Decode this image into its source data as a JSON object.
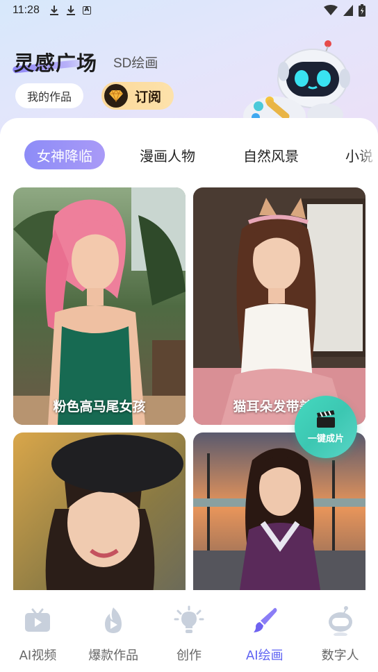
{
  "status_bar": {
    "time": "11:28"
  },
  "header": {
    "title": "灵感广场",
    "subtitle": "SD绘画",
    "my_works_label": "我的作品",
    "subscribe_label": "订阅"
  },
  "tabs": [
    {
      "label": "女神降临",
      "active": true
    },
    {
      "label": "漫画人物",
      "active": false
    },
    {
      "label": "自然风景",
      "active": false
    },
    {
      "label": "小说",
      "active": false
    }
  ],
  "cards": [
    {
      "caption": "粉色高马尾女孩"
    },
    {
      "caption": "猫耳朵发带美女"
    },
    {
      "caption": ""
    },
    {
      "caption": ""
    }
  ],
  "fab": {
    "label": "一键成片"
  },
  "bottom_nav": [
    {
      "label": "AI视频",
      "icon": "tv-icon",
      "active": false
    },
    {
      "label": "爆款作品",
      "icon": "flame-icon",
      "active": false
    },
    {
      "label": "创作",
      "icon": "lightbulb-icon",
      "active": false
    },
    {
      "label": "AI绘画",
      "icon": "brush-icon",
      "active": true
    },
    {
      "label": "数字人",
      "icon": "robot-head-icon",
      "active": false
    }
  ],
  "colors": {
    "accent": "#5f63f2",
    "tab_active": "#8d8cf7",
    "fab": "#45d9bf",
    "subscribe": "#fbd89a"
  }
}
